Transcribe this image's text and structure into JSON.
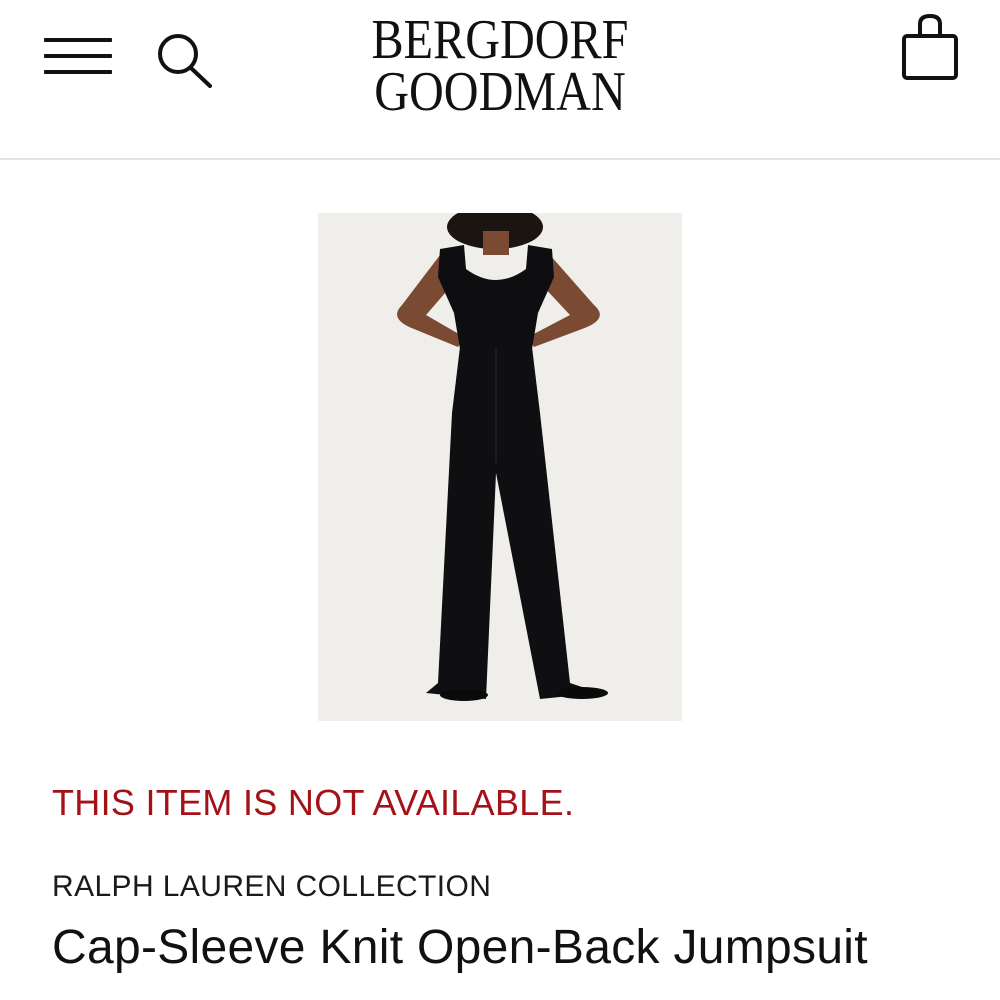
{
  "header": {
    "logo_line1": "BERGDORF",
    "logo_line2": "GOODMAN",
    "menu_icon": "hamburger-menu-icon",
    "search_icon": "search-icon",
    "bag_icon": "shopping-bag-icon"
  },
  "product": {
    "image_icon": "product-photo",
    "availability": "THIS ITEM IS NOT AVAILABLE.",
    "designer": "RALPH LAUREN COLLECTION",
    "name": "Cap-Sleeve Knit Open-Back Jumpsuit"
  },
  "colors": {
    "availability_red": "#a31218",
    "divider": "#e4e3ea",
    "image_background": "#efeeea"
  }
}
